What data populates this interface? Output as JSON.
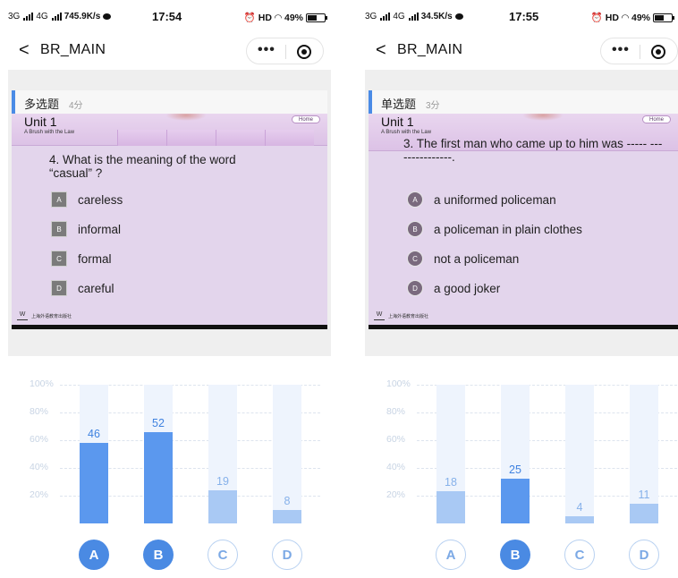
{
  "screens": [
    {
      "status": {
        "network": "3G",
        "network2": "4G",
        "speed": "745.9K/s",
        "time": "17:54",
        "hd": "HD",
        "battery": "49%"
      },
      "nav": {
        "back": "<",
        "title": "BR_MAIN",
        "more": "•••"
      },
      "question_type": {
        "name": "多选题",
        "score": "4分"
      },
      "slide": {
        "unit": "Unit 1",
        "subtitle": "A Brush with the Law",
        "home": "Home",
        "question": "4. What is the meaning of the word “casual” ?",
        "options": [
          {
            "letter": "A",
            "text": "careless"
          },
          {
            "letter": "B",
            "text": "informal"
          },
          {
            "letter": "C",
            "text": "formal"
          },
          {
            "letter": "D",
            "text": "careful"
          }
        ],
        "footer": "上海外语教育出版社"
      },
      "chart_data": {
        "type": "bar",
        "categories": [
          "A",
          "B",
          "C",
          "D"
        ],
        "values": [
          46,
          52,
          19,
          8
        ],
        "percent": [
          58,
          66,
          24,
          10
        ],
        "selected": [
          true,
          true,
          false,
          false
        ],
        "yticks": [
          "100%",
          "80%",
          "60%",
          "40%",
          "20%"
        ],
        "ylim": [
          0,
          100
        ]
      }
    },
    {
      "status": {
        "network": "3G",
        "network2": "4G",
        "speed": "34.5K/s",
        "time": "17:55",
        "hd": "HD",
        "battery": "49%"
      },
      "nav": {
        "back": "<",
        "title": "BR_MAIN",
        "more": "•••"
      },
      "question_type": {
        "name": "单选题",
        "score": "3分"
      },
      "slide": {
        "unit": "Unit 1",
        "subtitle": "A Brush with the Law",
        "home": "Home",
        "question": "3. The first man who came up to him was ----- ---------------.",
        "options": [
          {
            "letter": "A",
            "text": "a uniformed policeman"
          },
          {
            "letter": "B",
            "text": "a policeman in plain clothes"
          },
          {
            "letter": "C",
            "text": "not a policeman"
          },
          {
            "letter": "D",
            "text": "a good joker"
          }
        ],
        "footer": "上海外语教育出版社"
      },
      "chart_data": {
        "type": "bar",
        "categories": [
          "A",
          "B",
          "C",
          "D"
        ],
        "values": [
          18,
          25,
          4,
          11
        ],
        "percent": [
          23,
          32,
          5,
          14
        ],
        "selected": [
          false,
          true,
          false,
          false
        ],
        "yticks": [
          "100%",
          "80%",
          "60%",
          "40%",
          "20%"
        ],
        "ylim": [
          0,
          100
        ]
      }
    }
  ],
  "colors": {
    "bar_selected": "#5b98ee",
    "bar_unselected": "#a9c9f4",
    "bar_track": "#eef4fd",
    "label_selected": "#3f82e0",
    "label_unselected": "#86b1ea",
    "accent": "#4a8ae3"
  }
}
